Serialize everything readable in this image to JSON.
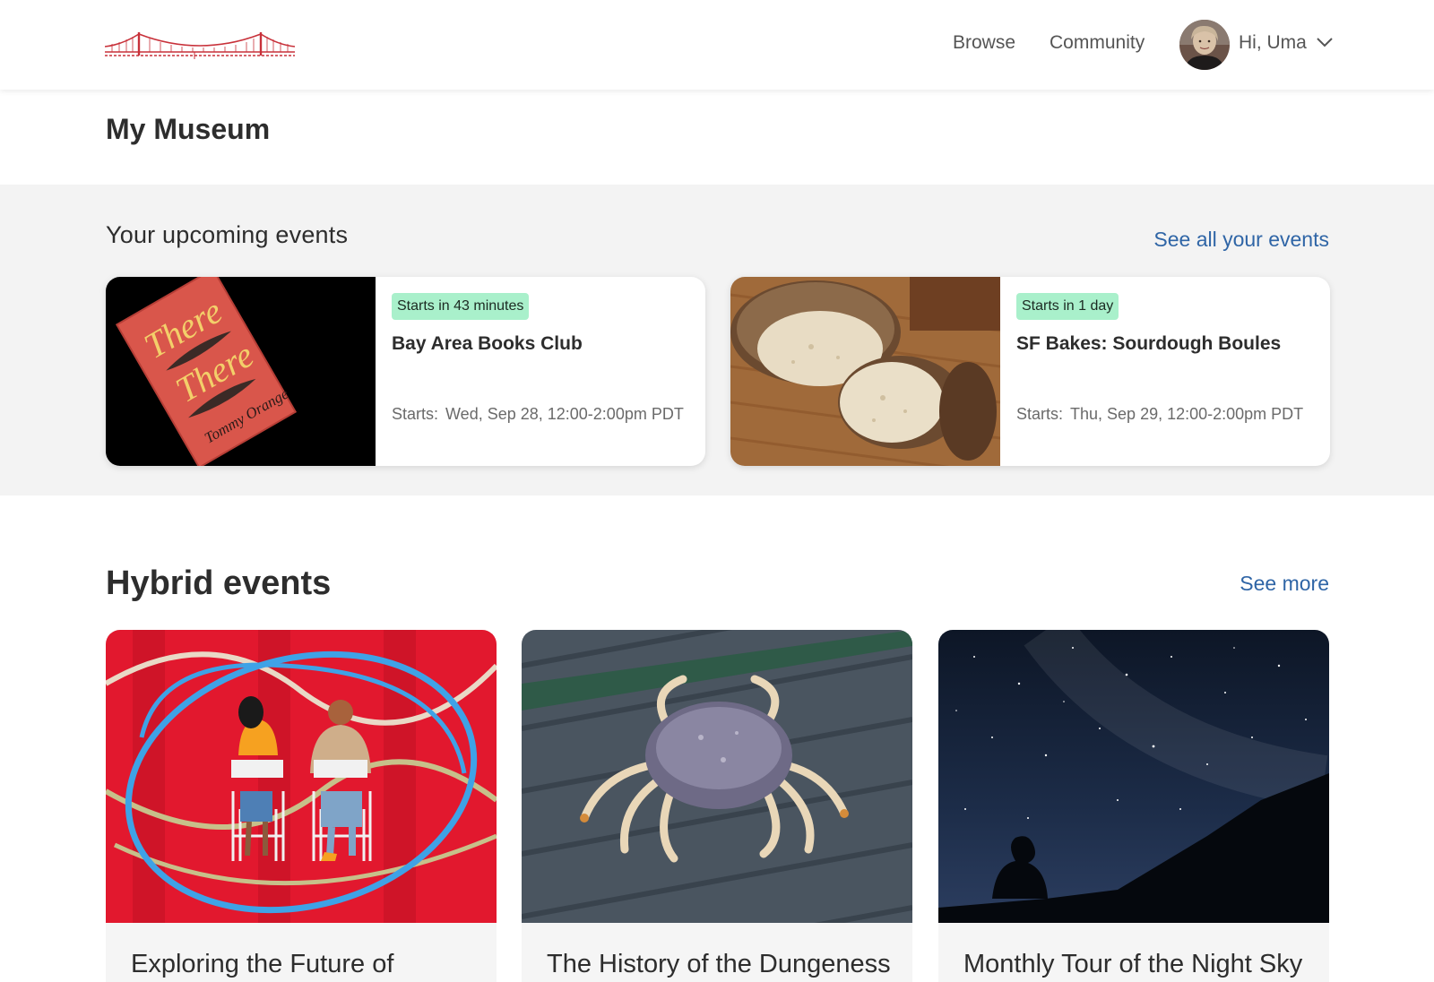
{
  "header": {
    "nav": [
      {
        "label": "Browse"
      },
      {
        "label": "Community"
      }
    ],
    "greeting": "Hi, Uma"
  },
  "page": {
    "title": "My Museum"
  },
  "upcoming": {
    "title": "Your upcoming events",
    "see_all": "See all your events",
    "events": [
      {
        "badge": "Starts in 43 minutes",
        "title": "Bay Area Books Club",
        "starts_label": "Starts:",
        "starts_value": "Wed, Sep 28, 12:00-2:00pm PDT"
      },
      {
        "badge": "Starts in 1 day",
        "title": "SF Bakes: Sourdough Boules",
        "starts_label": "Starts:",
        "starts_value": "Thu, Sep 29, 12:00-2:00pm PDT"
      }
    ]
  },
  "hybrid": {
    "title": "Hybrid events",
    "see_more": "See more",
    "cards": [
      {
        "title": "Exploring the Future of"
      },
      {
        "title": "The History of the Dungeness"
      },
      {
        "title": "Monthly Tour of the Night Sky"
      }
    ]
  },
  "book_cover": {
    "line1": "There",
    "line2": "There",
    "author": "Tommy Orange"
  },
  "colors": {
    "link": "#2f65a6",
    "badge_bg": "#a9f0cb",
    "brand_red": "#c8313a",
    "band_bg": "#f3f3f3"
  },
  "icons": {
    "logo": "golden-gate-bridge-logo",
    "chevron": "chevron-down-icon"
  }
}
